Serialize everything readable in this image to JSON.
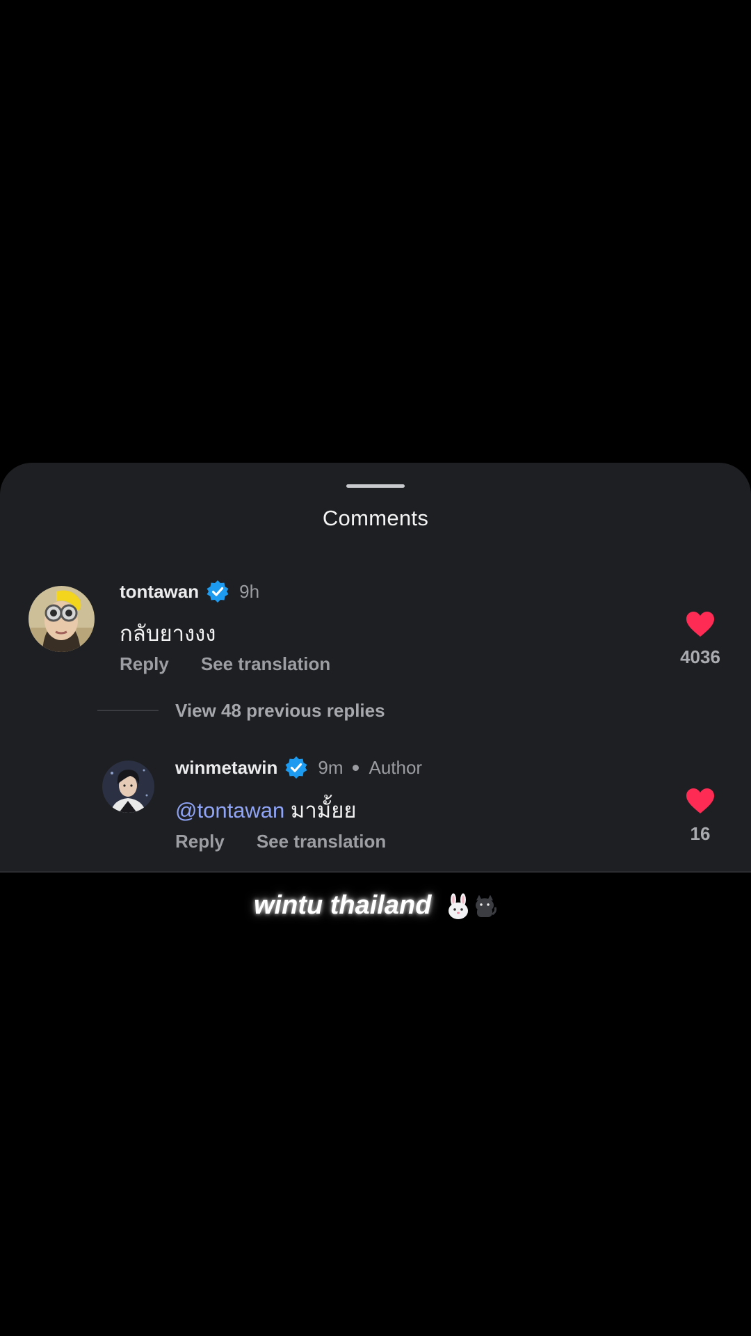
{
  "sheet": {
    "title": "Comments"
  },
  "comments": [
    {
      "username": "tontawan",
      "verified": true,
      "time": "9h",
      "text": "กลับยางงง",
      "reply_label": "Reply",
      "translate_label": "See translation",
      "likes": "4036",
      "avatar_icon": "avatar-yellow-hat"
    }
  ],
  "replies_toggle": {
    "label": "View 48 previous replies"
  },
  "replies": [
    {
      "username": "winmetawin",
      "verified": true,
      "time": "9m",
      "badge": "Author",
      "mention": "@tontawan",
      "text": "มามั้ยย",
      "reply_label": "Reply",
      "translate_label": "See translation",
      "likes": "16",
      "avatar_icon": "avatar-portrait"
    }
  ],
  "caption": {
    "text": "wintu thailand",
    "emoji_icons": [
      "rabbit-icon",
      "cat-icon"
    ]
  },
  "colors": {
    "sheet_background": "#1e1f22",
    "verified_badge": "#1d9bf0",
    "heart": "#fe2c55",
    "mention": "#8fa4f5"
  }
}
